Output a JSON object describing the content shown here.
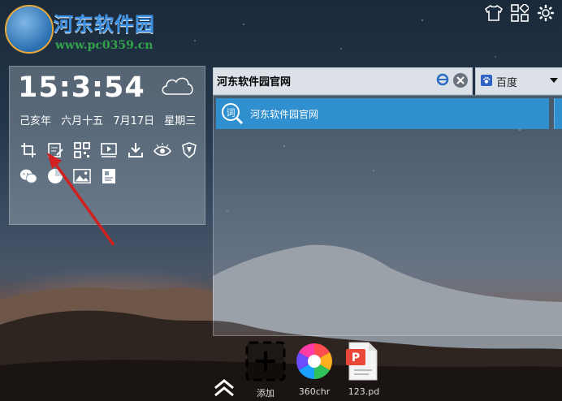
{
  "logo": {
    "title": "河东软件园",
    "url": "www.pc0359.cn"
  },
  "top_icons": [
    "tshirt-icon",
    "apps-grid-icon",
    "gear-icon"
  ],
  "clock": {
    "time": "15:3:54",
    "date_parts": [
      "己亥年",
      "六月十五",
      "7月17日",
      "星期三"
    ],
    "weather_icon": "cloud-icon"
  },
  "tools": {
    "row1": [
      "crop-icon",
      "note-edit-icon",
      "qr-code-icon",
      "video-icon",
      "download-icon",
      "eye-icon",
      "shield-icon"
    ],
    "row2": [
      "wechat-icon",
      "color-circle-icon",
      "image-icon",
      "book-icon"
    ]
  },
  "search": {
    "value": "河东软件园官网",
    "engine": "百度",
    "suggestions": [
      "河东软件园官网"
    ]
  },
  "dock": [
    {
      "label": "添加",
      "icon": "add-icon"
    },
    {
      "label": "360chr",
      "icon": "360-browser-icon"
    },
    {
      "label": "123.pd",
      "icon": "pdf-file-icon"
    }
  ],
  "colors": {
    "accent": "#2f8fcf",
    "logo_blue": "#3b8fe0",
    "logo_green": "#33a24a",
    "arrow_red": "#d0201f"
  }
}
